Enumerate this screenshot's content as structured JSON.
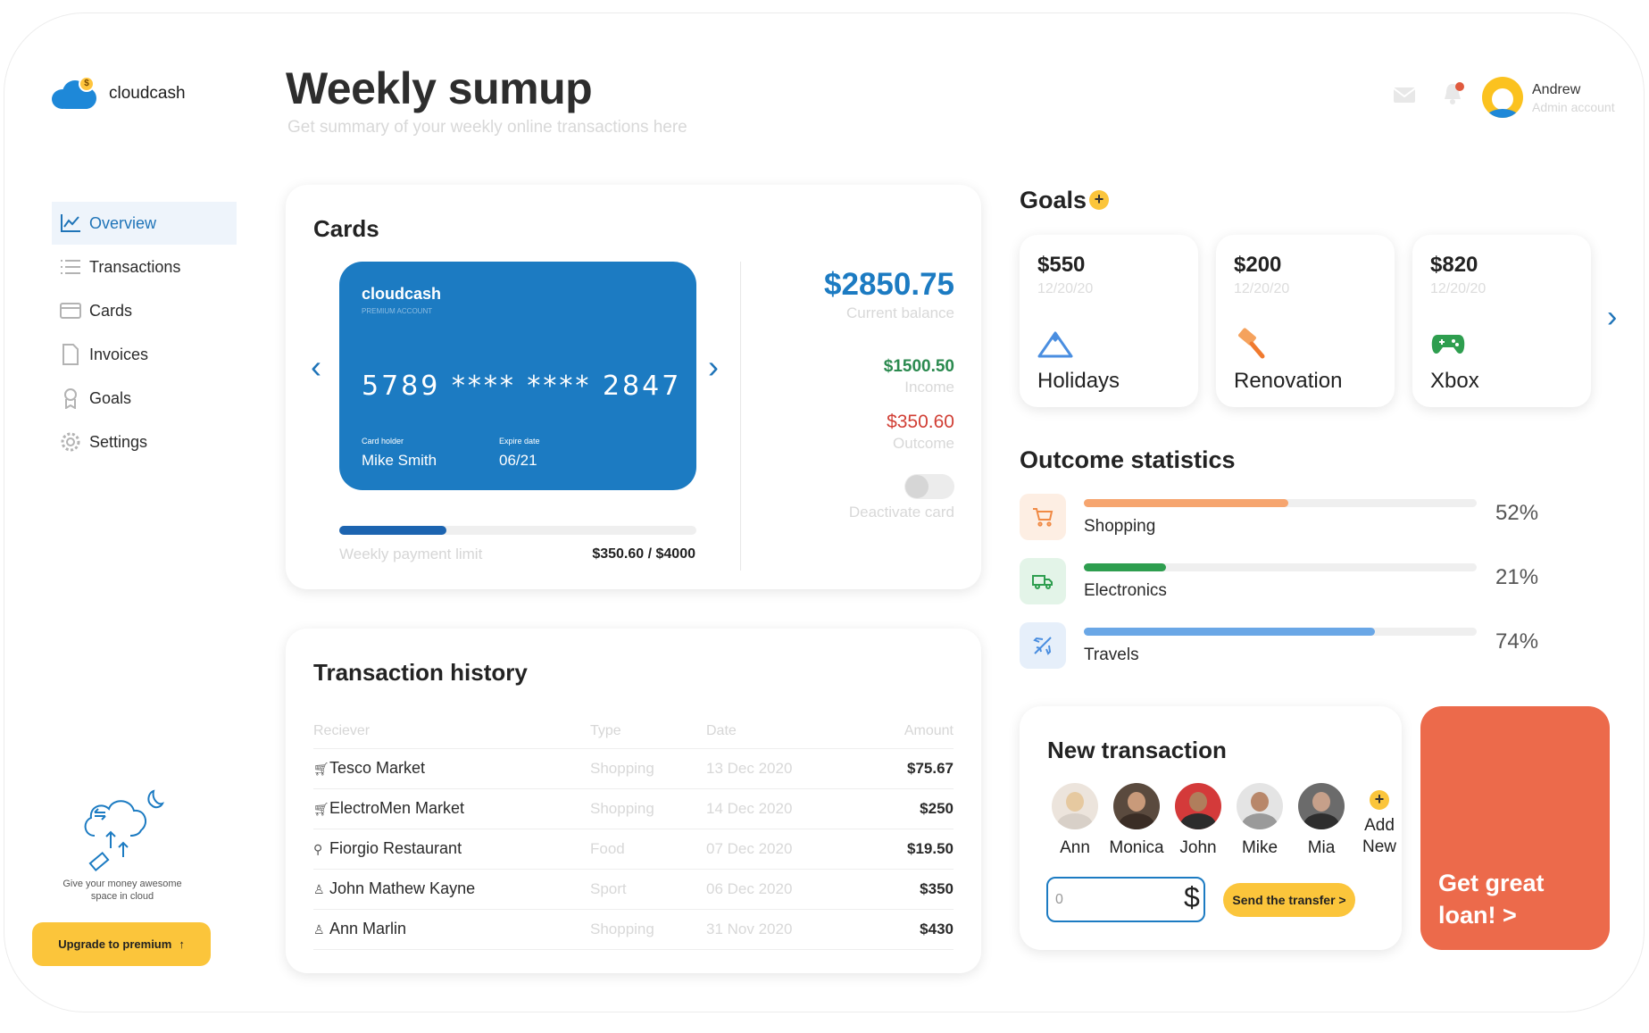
{
  "brand": {
    "name": "cloudcash"
  },
  "header": {
    "title": "Weekly sumup",
    "subtitle": "Get summary of your weekly online transactions here",
    "user_name": "Andrew",
    "user_role": "Admin account"
  },
  "sidebar": {
    "items": [
      {
        "label": "Overview",
        "icon": "chart-line-icon",
        "active": true
      },
      {
        "label": "Transactions",
        "icon": "list-icon",
        "active": false
      },
      {
        "label": "Cards",
        "icon": "card-icon",
        "active": false
      },
      {
        "label": "Invoices",
        "icon": "document-icon",
        "active": false
      },
      {
        "label": "Goals",
        "icon": "medal-icon",
        "active": false
      },
      {
        "label": "Settings",
        "icon": "gear-icon",
        "active": false
      }
    ],
    "promo_text": "Give your money awesome space in cloud",
    "upgrade_label": "Upgrade to premium"
  },
  "cards": {
    "title": "Cards",
    "card": {
      "bank": "cloudcash",
      "type": "PREMIUM ACCOUNT",
      "number": "5789 **** **** 2847",
      "holder_label": "Card holder",
      "holder": "Mike Smith",
      "expire_label": "Expire date",
      "expire": "06/21"
    },
    "limit_label": "Weekly payment limit",
    "limit_value": "$350.60 / $4000",
    "limit_fraction": 0.3,
    "balance": "$2850.75",
    "balance_label": "Current balance",
    "income": "$1500.50",
    "income_label": "Income",
    "outcome": "$350.60",
    "outcome_label": "Outcome",
    "deactivate_label": "Deactivate card"
  },
  "history": {
    "title": "Transaction history",
    "columns": [
      "Reciever",
      "Type",
      "Date",
      "Amount"
    ],
    "rows": [
      {
        "icon": "cart-icon",
        "receiver": "Tesco Market",
        "type": "Shopping",
        "date": "13 Dec 2020",
        "amount": "$75.67"
      },
      {
        "icon": "cart-icon",
        "receiver": "ElectroMen Market",
        "type": "Shopping",
        "date": "14 Dec 2020",
        "amount": "$250"
      },
      {
        "icon": "utensils-icon",
        "receiver": "Fiorgio Restaurant",
        "type": "Food",
        "date": "07 Dec 2020",
        "amount": "$19.50"
      },
      {
        "icon": "user-icon",
        "receiver": "John Mathew Kayne",
        "type": "Sport",
        "date": "06 Dec 2020",
        "amount": "$350"
      },
      {
        "icon": "user-icon",
        "receiver": "Ann Marlin",
        "type": "Shopping",
        "date": "31 Nov 2020",
        "amount": "$430"
      }
    ]
  },
  "goals": {
    "title": "Goals",
    "items": [
      {
        "amount": "$550",
        "date": "12/20/20",
        "name": "Holidays",
        "icon": "mountain-icon"
      },
      {
        "amount": "$200",
        "date": "12/20/20",
        "name": "Renovation",
        "icon": "paint-roller-icon"
      },
      {
        "amount": "$820",
        "date": "12/20/20",
        "name": "Xbox",
        "icon": "gamepad-icon"
      }
    ]
  },
  "outcome_stats": {
    "title": "Outcome statistics",
    "items": [
      {
        "name": "Shopping",
        "percent": "52%",
        "value": 52,
        "color": "#f6a56f",
        "bg": "#fdeee3",
        "icon": "cart-icon"
      },
      {
        "name": "Electronics",
        "percent": "21%",
        "value": 21,
        "color": "#2e9e4f",
        "bg": "#e3f4e8",
        "icon": "truck-icon"
      },
      {
        "name": "Travels",
        "percent": "74%",
        "value": 74,
        "color": "#6aa7e6",
        "bg": "#e6effa",
        "icon": "plane-icon"
      }
    ]
  },
  "new_transaction": {
    "title": "New transaction",
    "contacts": [
      "Ann",
      "Monica",
      "John",
      "Mike",
      "Mia"
    ],
    "add_new_line1": "Add",
    "add_new_line2": "New",
    "amount_value": "0",
    "currency": "$",
    "send_label": "Send the transfer >"
  },
  "loan": {
    "label": "Get great loan! >"
  },
  "colors": {
    "accent": "#1c7bc2",
    "yellow": "#fbc53b",
    "loan": "#ec6a4b"
  }
}
